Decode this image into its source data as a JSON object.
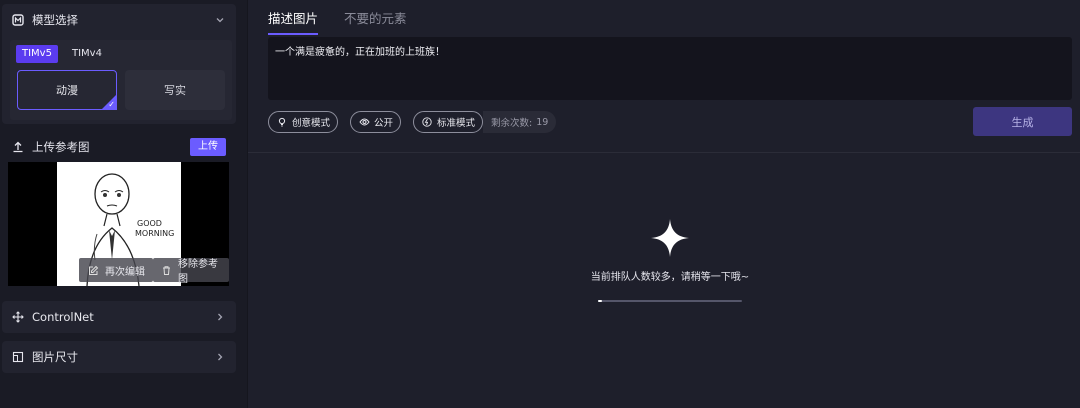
{
  "left": {
    "model": {
      "title": "模型选择",
      "versions": [
        "TIMv5",
        "TIMv4"
      ],
      "styles": [
        "动漫",
        "写实"
      ]
    },
    "upload": {
      "title": "上传参考图",
      "button": "上传",
      "edit": "再次编辑",
      "remove": "移除参考图",
      "image_text": "GOOD MORNING"
    },
    "controlnet": {
      "title": "ControlNet"
    },
    "size": {
      "title": "图片尺寸"
    }
  },
  "tabs": [
    "描述图片",
    "不要的元素"
  ],
  "prompt": "一个满是疲惫的，正在加班的上班族！",
  "pills": {
    "creative": "创意模式",
    "public": "公开",
    "standard": "标准模式",
    "remain_label": "剩余次数:",
    "remain_count": "19"
  },
  "generate": "生成",
  "status": {
    "text": "当前排队人数较多，请稍等一下哦~",
    "progress": 0.03
  },
  "colors": {
    "accent": "#6b5cff",
    "version_active": "#5b3cf0",
    "generate": "#3d3680"
  }
}
